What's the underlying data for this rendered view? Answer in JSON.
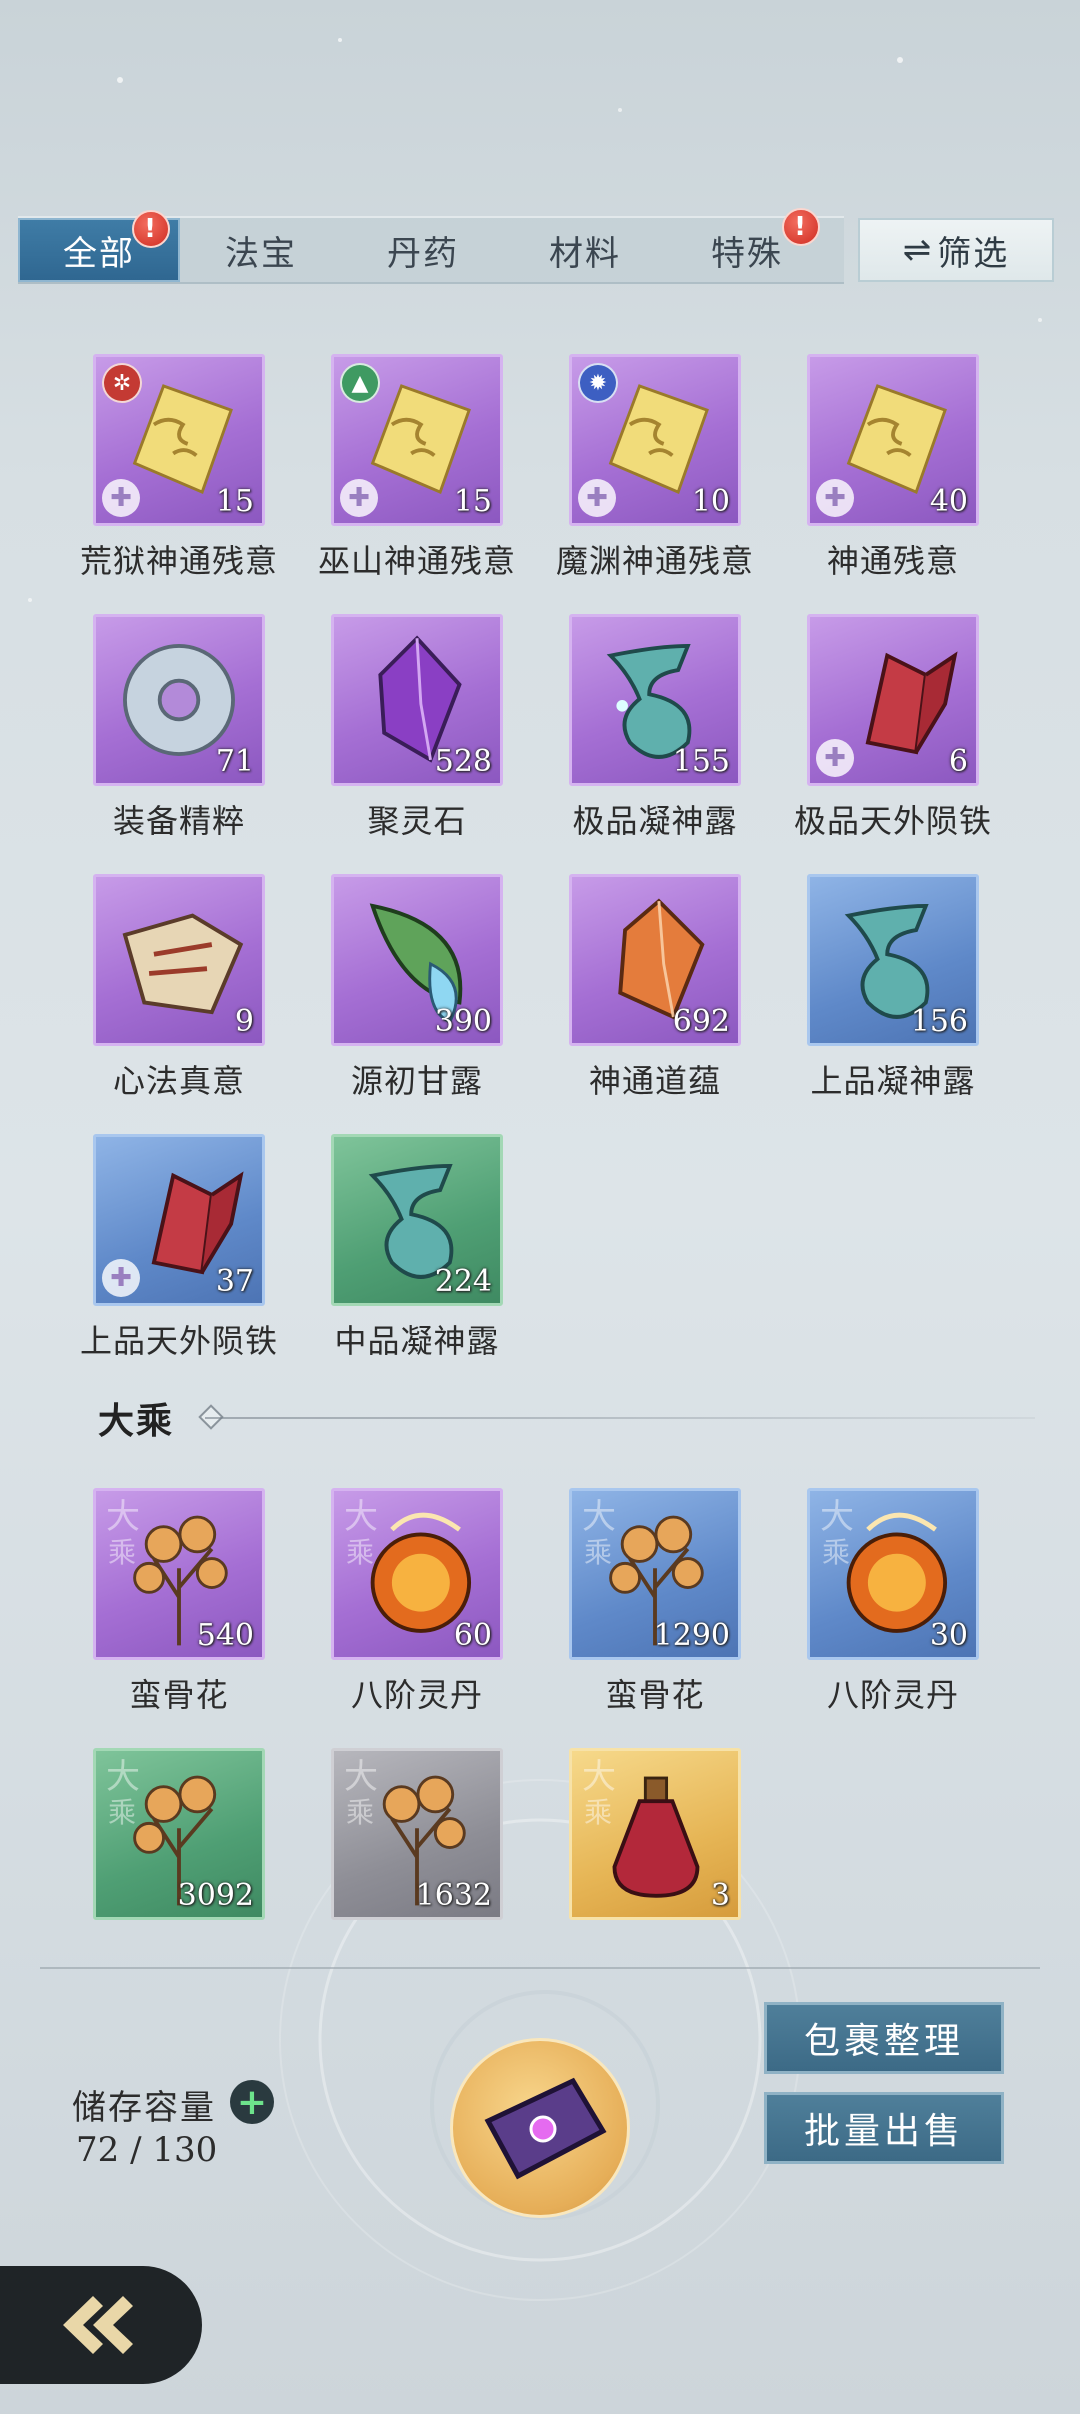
{
  "tabs": [
    {
      "label": "全部",
      "active": true,
      "badge": "!"
    },
    {
      "label": "法宝",
      "active": false,
      "badge": ""
    },
    {
      "label": "丹药",
      "active": false,
      "badge": ""
    },
    {
      "label": "材料",
      "active": false,
      "badge": ""
    },
    {
      "label": "特殊",
      "active": false,
      "badge": "!"
    }
  ],
  "filter": {
    "icon": "⇌",
    "label": "筛选"
  },
  "items": [
    {
      "name": "荒狱神通残意",
      "qty": "15",
      "rarity": "purple",
      "icon": "golden-fragment-icon",
      "emblem": "red-seal-emblem",
      "puzzle": true
    },
    {
      "name": "巫山神通残意",
      "qty": "15",
      "rarity": "purple",
      "icon": "golden-fragment-icon",
      "emblem": "green-mountain-emblem",
      "puzzle": true
    },
    {
      "name": "魔渊神通残意",
      "qty": "10",
      "rarity": "purple",
      "icon": "golden-fragment-icon",
      "emblem": "blue-demon-emblem",
      "puzzle": true
    },
    {
      "name": "神通残意",
      "qty": "40",
      "rarity": "purple",
      "icon": "golden-fragment-icon",
      "emblem": "",
      "puzzle": true
    },
    {
      "name": "装备精粹",
      "qty": "71",
      "rarity": "purple",
      "icon": "jade-ring-icon",
      "emblem": "",
      "puzzle": false
    },
    {
      "name": "聚灵石",
      "qty": "528",
      "rarity": "purple",
      "icon": "purple-crystal-icon",
      "emblem": "",
      "puzzle": false
    },
    {
      "name": "极品凝神露",
      "qty": "155",
      "rarity": "purple",
      "icon": "dew-vase-icon",
      "emblem": "",
      "puzzle": false
    },
    {
      "name": "极品天外陨铁",
      "qty": "6",
      "rarity": "purple",
      "icon": "red-meteor-iron-icon",
      "emblem": "",
      "puzzle": true
    },
    {
      "name": "心法真意",
      "qty": "9",
      "rarity": "purple",
      "icon": "scroll-treasure-icon",
      "emblem": "",
      "puzzle": false
    },
    {
      "name": "源初甘露",
      "qty": "390",
      "rarity": "purple",
      "icon": "leaf-dew-icon",
      "emblem": "",
      "puzzle": false
    },
    {
      "name": "神通道蕴",
      "qty": "692",
      "rarity": "purple",
      "icon": "amber-crystal-icon",
      "emblem": "",
      "puzzle": false
    },
    {
      "name": "上品凝神露",
      "qty": "156",
      "rarity": "blue",
      "icon": "dew-vase-icon",
      "emblem": "",
      "puzzle": false
    },
    {
      "name": "上品天外陨铁",
      "qty": "37",
      "rarity": "blue",
      "icon": "red-meteor-iron-icon",
      "emblem": "",
      "puzzle": true
    },
    {
      "name": "中品凝神露",
      "qty": "224",
      "rarity": "green",
      "icon": "dew-vase-icon",
      "emblem": "",
      "puzzle": false
    }
  ],
  "section": {
    "title": "大乘"
  },
  "tier_mark": {
    "line1": "大",
    "line2": "乘"
  },
  "section_items": [
    {
      "name": "蛮骨花",
      "qty": "540",
      "rarity": "purple",
      "icon": "bone-flower-icon"
    },
    {
      "name": "八阶灵丹",
      "qty": "60",
      "rarity": "purple",
      "icon": "flame-pill-icon"
    },
    {
      "name": "蛮骨花",
      "qty": "1290",
      "rarity": "blue",
      "icon": "bone-flower-icon"
    },
    {
      "name": "八阶灵丹",
      "qty": "30",
      "rarity": "blue",
      "icon": "flame-pill-icon"
    },
    {
      "name": "",
      "qty": "3092",
      "rarity": "green",
      "icon": "bone-flower-icon"
    },
    {
      "name": "",
      "qty": "1632",
      "rarity": "gray",
      "icon": "bone-flower-icon"
    },
    {
      "name": "",
      "qty": "3",
      "rarity": "gold",
      "icon": "potion-bottle-icon"
    }
  ],
  "storage": {
    "label": "储存容量",
    "plus": "+",
    "value": "72 / 130"
  },
  "buttons": {
    "sort": "包裹整理",
    "sell": "批量出售"
  },
  "colors": {
    "active_tab": "#3a77a2",
    "action_button": "#46758f",
    "badge": "#d9362b"
  }
}
